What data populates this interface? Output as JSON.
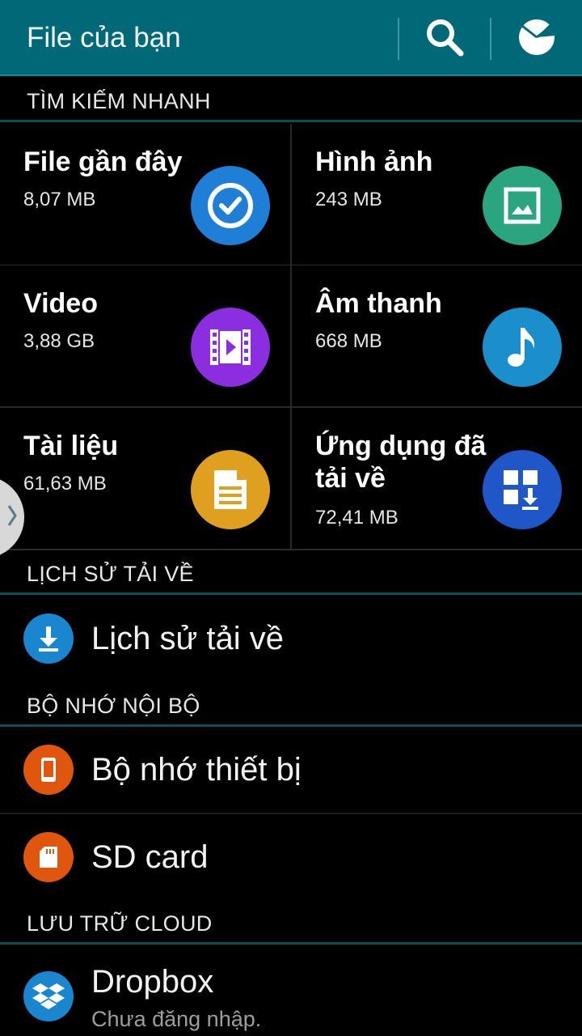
{
  "appbar": {
    "title": "File của bạn",
    "icons": [
      "search-icon",
      "storage-usage-icon"
    ]
  },
  "sections": {
    "quick_search": "TÌM KIẾM NHANH",
    "download_history": "LỊCH SỬ TẢI VỀ",
    "internal_storage": "BỘ NHỚ NỘI BỘ",
    "cloud_storage": "LƯU TRỮ CLOUD"
  },
  "tiles": [
    {
      "title": "File gần đây",
      "size": "8,07 MB",
      "color": "#1f7fd6",
      "icon": "recent-check-icon"
    },
    {
      "title": "Hình ảnh",
      "size": "243 MB",
      "color": "#2aa57f",
      "icon": "image-icon"
    },
    {
      "title": "Video",
      "size": "3,88 GB",
      "color": "#8a2ee0",
      "icon": "video-icon"
    },
    {
      "title": "Âm thanh",
      "size": "668 MB",
      "color": "#1b8fcc",
      "icon": "music-note-icon"
    },
    {
      "title": "Tài liệu",
      "size": "61,63 MB",
      "color": "#e0a01f",
      "icon": "document-icon"
    },
    {
      "title": "Ứng dụng đã tải về",
      "size": "72,41 MB",
      "color": "#1f56c8",
      "icon": "apps-download-icon"
    }
  ],
  "rows": {
    "download_history": {
      "label": "Lịch sử tải về",
      "color": "#1a86d0",
      "icon": "download-icon"
    },
    "device_storage": {
      "label": "Bộ nhớ thiết bị",
      "color": "#e0560d",
      "icon": "phone-icon"
    },
    "sd_card": {
      "label": "SD card",
      "color": "#e0560d",
      "icon": "sd-card-icon"
    },
    "dropbox": {
      "label": "Dropbox",
      "sublabel": "Chưa đăng nhập.",
      "color": "#1a86d0",
      "icon": "dropbox-icon"
    }
  }
}
